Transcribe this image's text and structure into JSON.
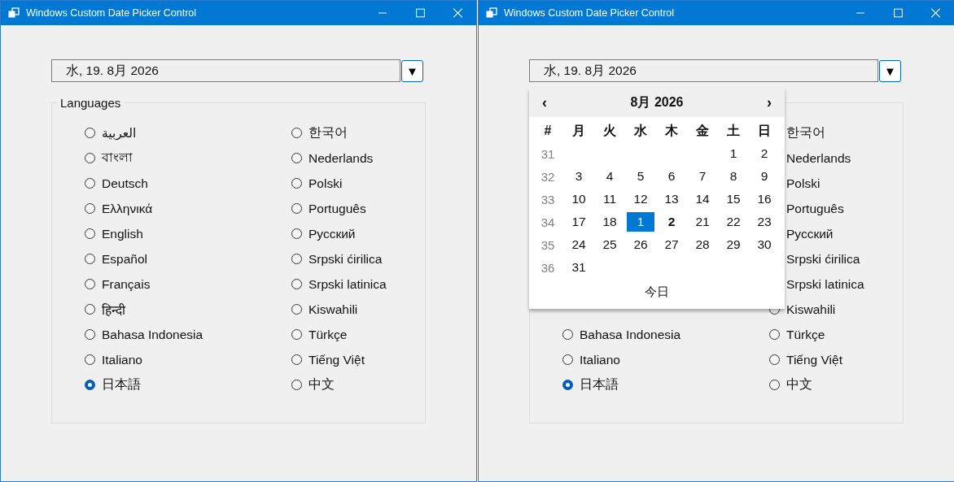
{
  "windows": [
    {
      "title": "Windows Custom Date Picker Control",
      "date_field": {
        "value": "水, 19. 8月 2026"
      },
      "dropdown_button": {
        "label": "▼"
      },
      "group": {
        "legend": "Languages",
        "columns": [
          [
            {
              "label": "العربية",
              "selected": false
            },
            {
              "label": "বাংলা",
              "selected": false
            },
            {
              "label": "Deutsch",
              "selected": false
            },
            {
              "label": "Ελληνικά",
              "selected": false
            },
            {
              "label": "English",
              "selected": false
            },
            {
              "label": "Español",
              "selected": false
            },
            {
              "label": "Français",
              "selected": false
            },
            {
              "label": "हिन्दी",
              "selected": false
            },
            {
              "label": "Bahasa Indonesia",
              "selected": false
            },
            {
              "label": "Italiano",
              "selected": false
            },
            {
              "label": "日本語",
              "selected": true
            }
          ],
          [
            {
              "label": "한국어",
              "selected": false
            },
            {
              "label": "Nederlands",
              "selected": false
            },
            {
              "label": "Polski",
              "selected": false
            },
            {
              "label": "Português",
              "selected": false
            },
            {
              "label": "Русский",
              "selected": false
            },
            {
              "label": "Srpski ćirilica",
              "selected": false
            },
            {
              "label": "Srpski latinica",
              "selected": false
            },
            {
              "label": "Kiswahili",
              "selected": false
            },
            {
              "label": "Türkçe",
              "selected": false
            },
            {
              "label": "Tiếng Việt",
              "selected": false
            },
            {
              "label": "中文",
              "selected": false
            }
          ]
        ]
      }
    },
    {
      "title": "Windows Custom Date Picker Control",
      "date_field": {
        "value": "水, 19. 8月 2026"
      },
      "dropdown_button": {
        "label": "▼"
      },
      "group": {
        "columns": [
          [
            {
              "label": "Bahasa Indonesia",
              "selected": false
            },
            {
              "label": "Italiano",
              "selected": false
            },
            {
              "label": "日本語",
              "selected": true
            }
          ],
          [
            {
              "label": "한국어"
            },
            {
              "label": "Nederlands"
            },
            {
              "label": "Polski"
            },
            {
              "label": "Português"
            },
            {
              "label": "Русский"
            },
            {
              "label": "Srpski ćirilica"
            },
            {
              "label": "Srpski latinica"
            },
            {
              "label": "Kiswahili",
              "selected": false
            },
            {
              "label": "Türkçe",
              "selected": false
            },
            {
              "label": "Tiếng Việt",
              "selected": false
            },
            {
              "label": "中文",
              "selected": false
            }
          ]
        ]
      },
      "calendar": {
        "prev": "‹",
        "title": "8月 2026",
        "next": "›",
        "headers": [
          "#",
          "月",
          "火",
          "水",
          "木",
          "金",
          "土",
          "日"
        ],
        "weeks": [
          {
            "week": "31",
            "days": [
              {
                "kind": "blank"
              },
              {
                "kind": "blank"
              },
              {
                "kind": "blank"
              },
              {
                "kind": "blank"
              },
              {
                "kind": "blank"
              },
              {
                "kind": "day",
                "text": "1",
                "selected": false,
                "today": false
              },
              {
                "kind": "day",
                "text": "2",
                "selected": false,
                "today": false
              }
            ]
          },
          {
            "week": "32",
            "days": [
              {
                "kind": "day",
                "text": "3",
                "selected": false,
                "today": false
              },
              {
                "kind": "day",
                "text": "4",
                "selected": false,
                "today": false
              },
              {
                "kind": "day",
                "text": "5",
                "selected": false,
                "today": false
              },
              {
                "kind": "day",
                "text": "6",
                "selected": false,
                "today": false
              },
              {
                "kind": "day",
                "text": "7",
                "selected": false,
                "today": false
              },
              {
                "kind": "day",
                "text": "8",
                "selected": false,
                "today": false
              },
              {
                "kind": "day",
                "text": "9",
                "selected": false,
                "today": false
              }
            ]
          },
          {
            "week": "33",
            "days": [
              {
                "kind": "day",
                "text": "10",
                "selected": false,
                "today": false
              },
              {
                "kind": "day",
                "text": "11",
                "selected": false,
                "today": false
              },
              {
                "kind": "day",
                "text": "12",
                "selected": false,
                "today": false
              },
              {
                "kind": "day",
                "text": "13",
                "selected": false,
                "today": false
              },
              {
                "kind": "day",
                "text": "14",
                "selected": false,
                "today": false
              },
              {
                "kind": "day",
                "text": "15",
                "selected": false,
                "today": false
              },
              {
                "kind": "day",
                "text": "16",
                "selected": false,
                "today": false
              }
            ]
          },
          {
            "week": "34",
            "days": [
              {
                "kind": "day",
                "text": "17",
                "selected": false,
                "today": false
              },
              {
                "kind": "day",
                "text": "18",
                "selected": false,
                "today": false
              },
              {
                "kind": "day",
                "text": "1",
                "selected": true,
                "today": false
              },
              {
                "kind": "day",
                "text": "2",
                "selected": false,
                "today": true
              },
              {
                "kind": "day",
                "text": "21",
                "selected": false,
                "today": false
              },
              {
                "kind": "day",
                "text": "22",
                "selected": false,
                "today": false
              },
              {
                "kind": "day",
                "text": "23",
                "selected": false,
                "today": false
              }
            ]
          },
          {
            "week": "35",
            "days": [
              {
                "kind": "day",
                "text": "24",
                "selected": false,
                "today": false
              },
              {
                "kind": "day",
                "text": "25",
                "selected": false,
                "today": false
              },
              {
                "kind": "day",
                "text": "26",
                "selected": false,
                "today": false
              },
              {
                "kind": "day",
                "text": "27",
                "selected": false,
                "today": false
              },
              {
                "kind": "day",
                "text": "28",
                "selected": false,
                "today": false
              },
              {
                "kind": "day",
                "text": "29",
                "selected": false,
                "today": false
              },
              {
                "kind": "day",
                "text": "30",
                "selected": false,
                "today": false
              }
            ]
          },
          {
            "week": "36",
            "days": [
              {
                "kind": "day",
                "text": "31",
                "selected": false,
                "today": false
              },
              {
                "kind": "blank"
              },
              {
                "kind": "blank"
              },
              {
                "kind": "blank"
              },
              {
                "kind": "blank"
              },
              {
                "kind": "blank"
              },
              {
                "kind": "blank"
              }
            ]
          }
        ],
        "today_button": "今日"
      }
    }
  ]
}
